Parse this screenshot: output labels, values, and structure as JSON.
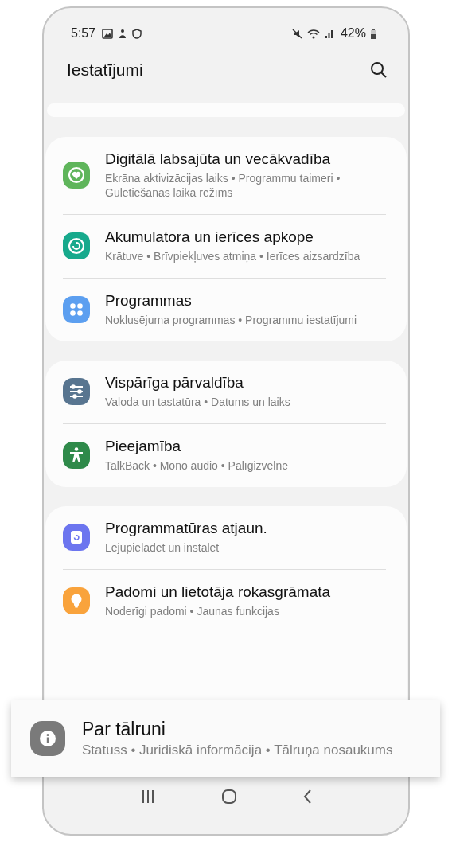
{
  "status_bar": {
    "time": "5:57",
    "battery": "42%"
  },
  "header": {
    "title": "Iestatījumi"
  },
  "groups": [
    {
      "items": [
        {
          "kind": "wellbeing",
          "title": "Digitālā labsajūta un vecākvadība",
          "subtitle": "Ekrāna aktivizācijas laiks  •  Programmu taimeri  •  Gulētiešanas laika režīms"
        },
        {
          "kind": "care",
          "title": "Akumulatora un ierīces apkope",
          "subtitle": "Krātuve  •  Brīvpiekļuves atmiņa  •  Ierīces aizsardzība"
        },
        {
          "kind": "apps",
          "title": "Programmas",
          "subtitle": "Noklusējuma programmas  •  Programmu iestatījumi"
        }
      ]
    },
    {
      "items": [
        {
          "kind": "general",
          "title": "Vispārīga pārvaldība",
          "subtitle": "Valoda un tastatūra  •  Datums un laiks"
        },
        {
          "kind": "accessibility",
          "title": "Pieejamība",
          "subtitle": "TalkBack  •  Mono audio  •  Palīgizvēlne"
        }
      ]
    },
    {
      "items": [
        {
          "kind": "update",
          "title": "Programmatūras atjaun.",
          "subtitle": "Lejupielādēt un instalēt"
        },
        {
          "kind": "tips",
          "title": "Padomi un lietotāja rokasgrāmata",
          "subtitle": "Noderīgi padomi  •  Jaunas funkcijas"
        }
      ]
    }
  ],
  "highlighted_item": {
    "kind": "about",
    "title": "Par tālruni",
    "subtitle": "Statuss  •  Juridiskā informācija  •  Tālruņa nosaukums"
  }
}
